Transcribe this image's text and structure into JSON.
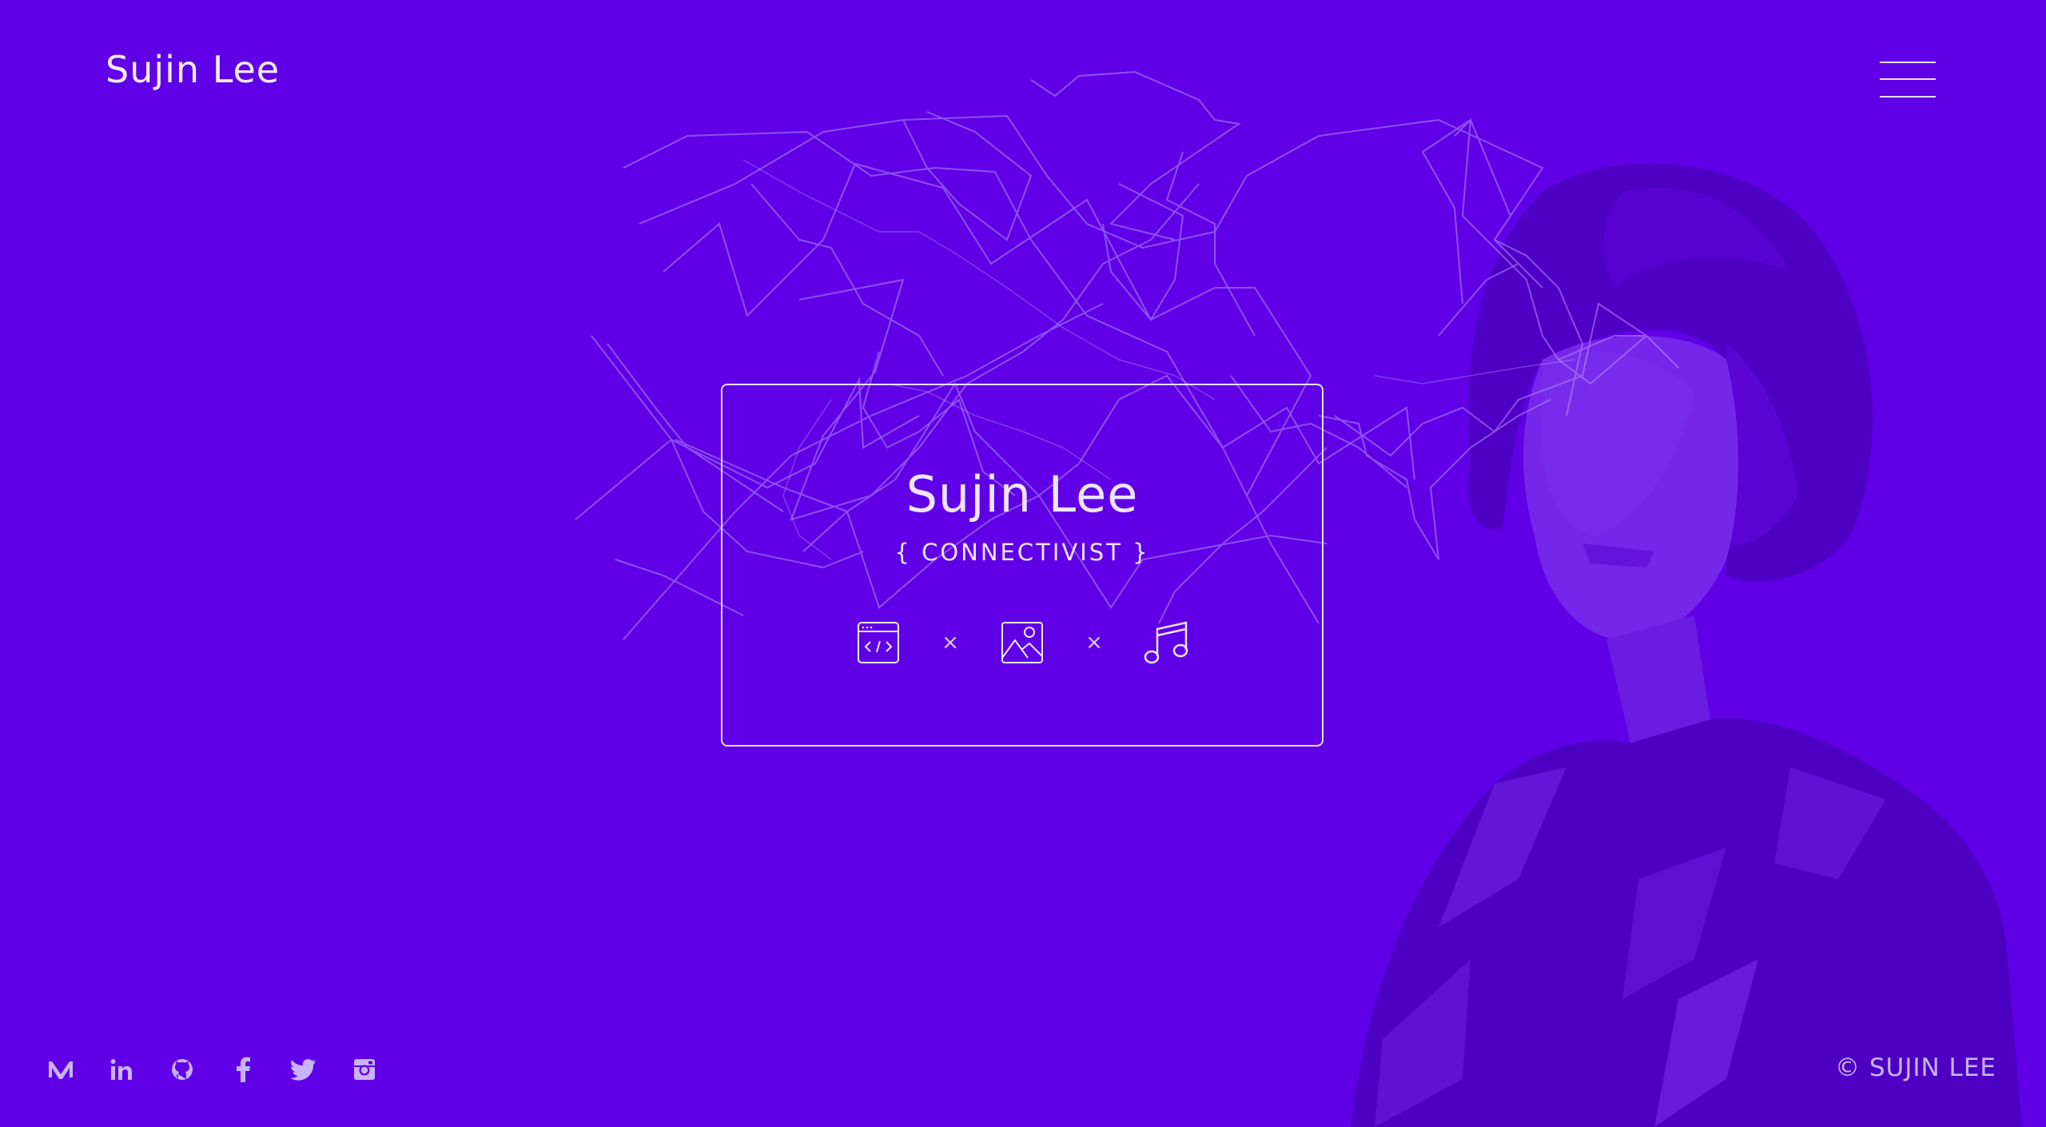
{
  "header": {
    "brand": "Sujin Lee",
    "menu_icon": "hamburger-menu-icon"
  },
  "hero": {
    "name": "Sujin Lee",
    "subtitle": "{ CONNECTIVIST }",
    "skills": [
      {
        "icon": "code-window-icon"
      },
      {
        "icon": "image-icon"
      },
      {
        "icon": "music-note-icon"
      }
    ],
    "separator": "×"
  },
  "footer": {
    "social": [
      {
        "icon": "medium-icon"
      },
      {
        "icon": "linkedin-icon"
      },
      {
        "icon": "github-icon"
      },
      {
        "icon": "facebook-icon"
      },
      {
        "icon": "twitter-icon"
      },
      {
        "icon": "instagram-icon"
      }
    ],
    "copyright": "© SUJIN LEE"
  },
  "colors": {
    "background": "#5f00e7",
    "line": "#b891ff",
    "text": "#eee4ff",
    "muted": "#c9b2ff"
  }
}
